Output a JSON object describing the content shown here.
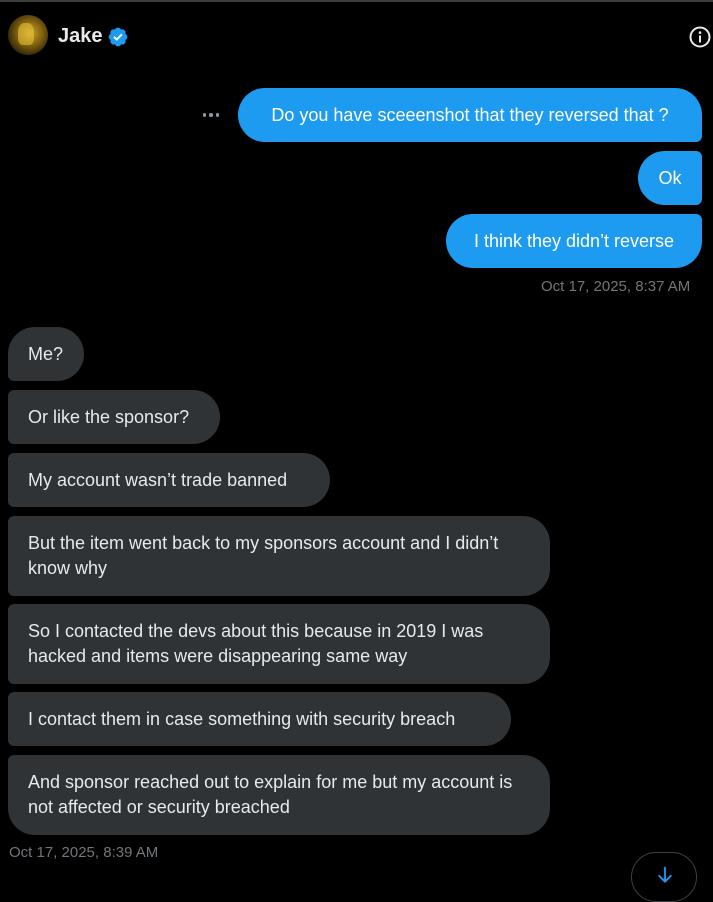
{
  "header": {
    "name": "Jake",
    "verified_icon": "verified-badge-icon",
    "info_icon": "info-icon"
  },
  "colors": {
    "accent": "#1d9bf0",
    "received_bubble": "#2f3336",
    "background": "#000000",
    "muted_text": "#71767b"
  },
  "sent_messages": [
    {
      "text": "Do you have sceeenshot that they reversed that ?"
    },
    {
      "text": "Ok"
    },
    {
      "text": "I think they didn’t reverse"
    }
  ],
  "sent_timestamp": "Oct 17, 2025, 8:37 AM",
  "received_messages": [
    {
      "text": "Me?"
    },
    {
      "text": "Or like the sponsor?"
    },
    {
      "text": "My account wasn’t trade banned"
    },
    {
      "text": "But the item went back to my sponsors account and I didn’t know why"
    },
    {
      "text": "So I contacted the devs about this because in 2019 I was hacked and items were disappearing same way"
    },
    {
      "text": "I contact them in case something with security breach"
    },
    {
      "text": "And sponsor reached out to explain for me but my account is not affected or security breached"
    }
  ],
  "received_timestamp": "Oct 17, 2025, 8:39 AM",
  "scroll_icon": "arrow-down-icon"
}
